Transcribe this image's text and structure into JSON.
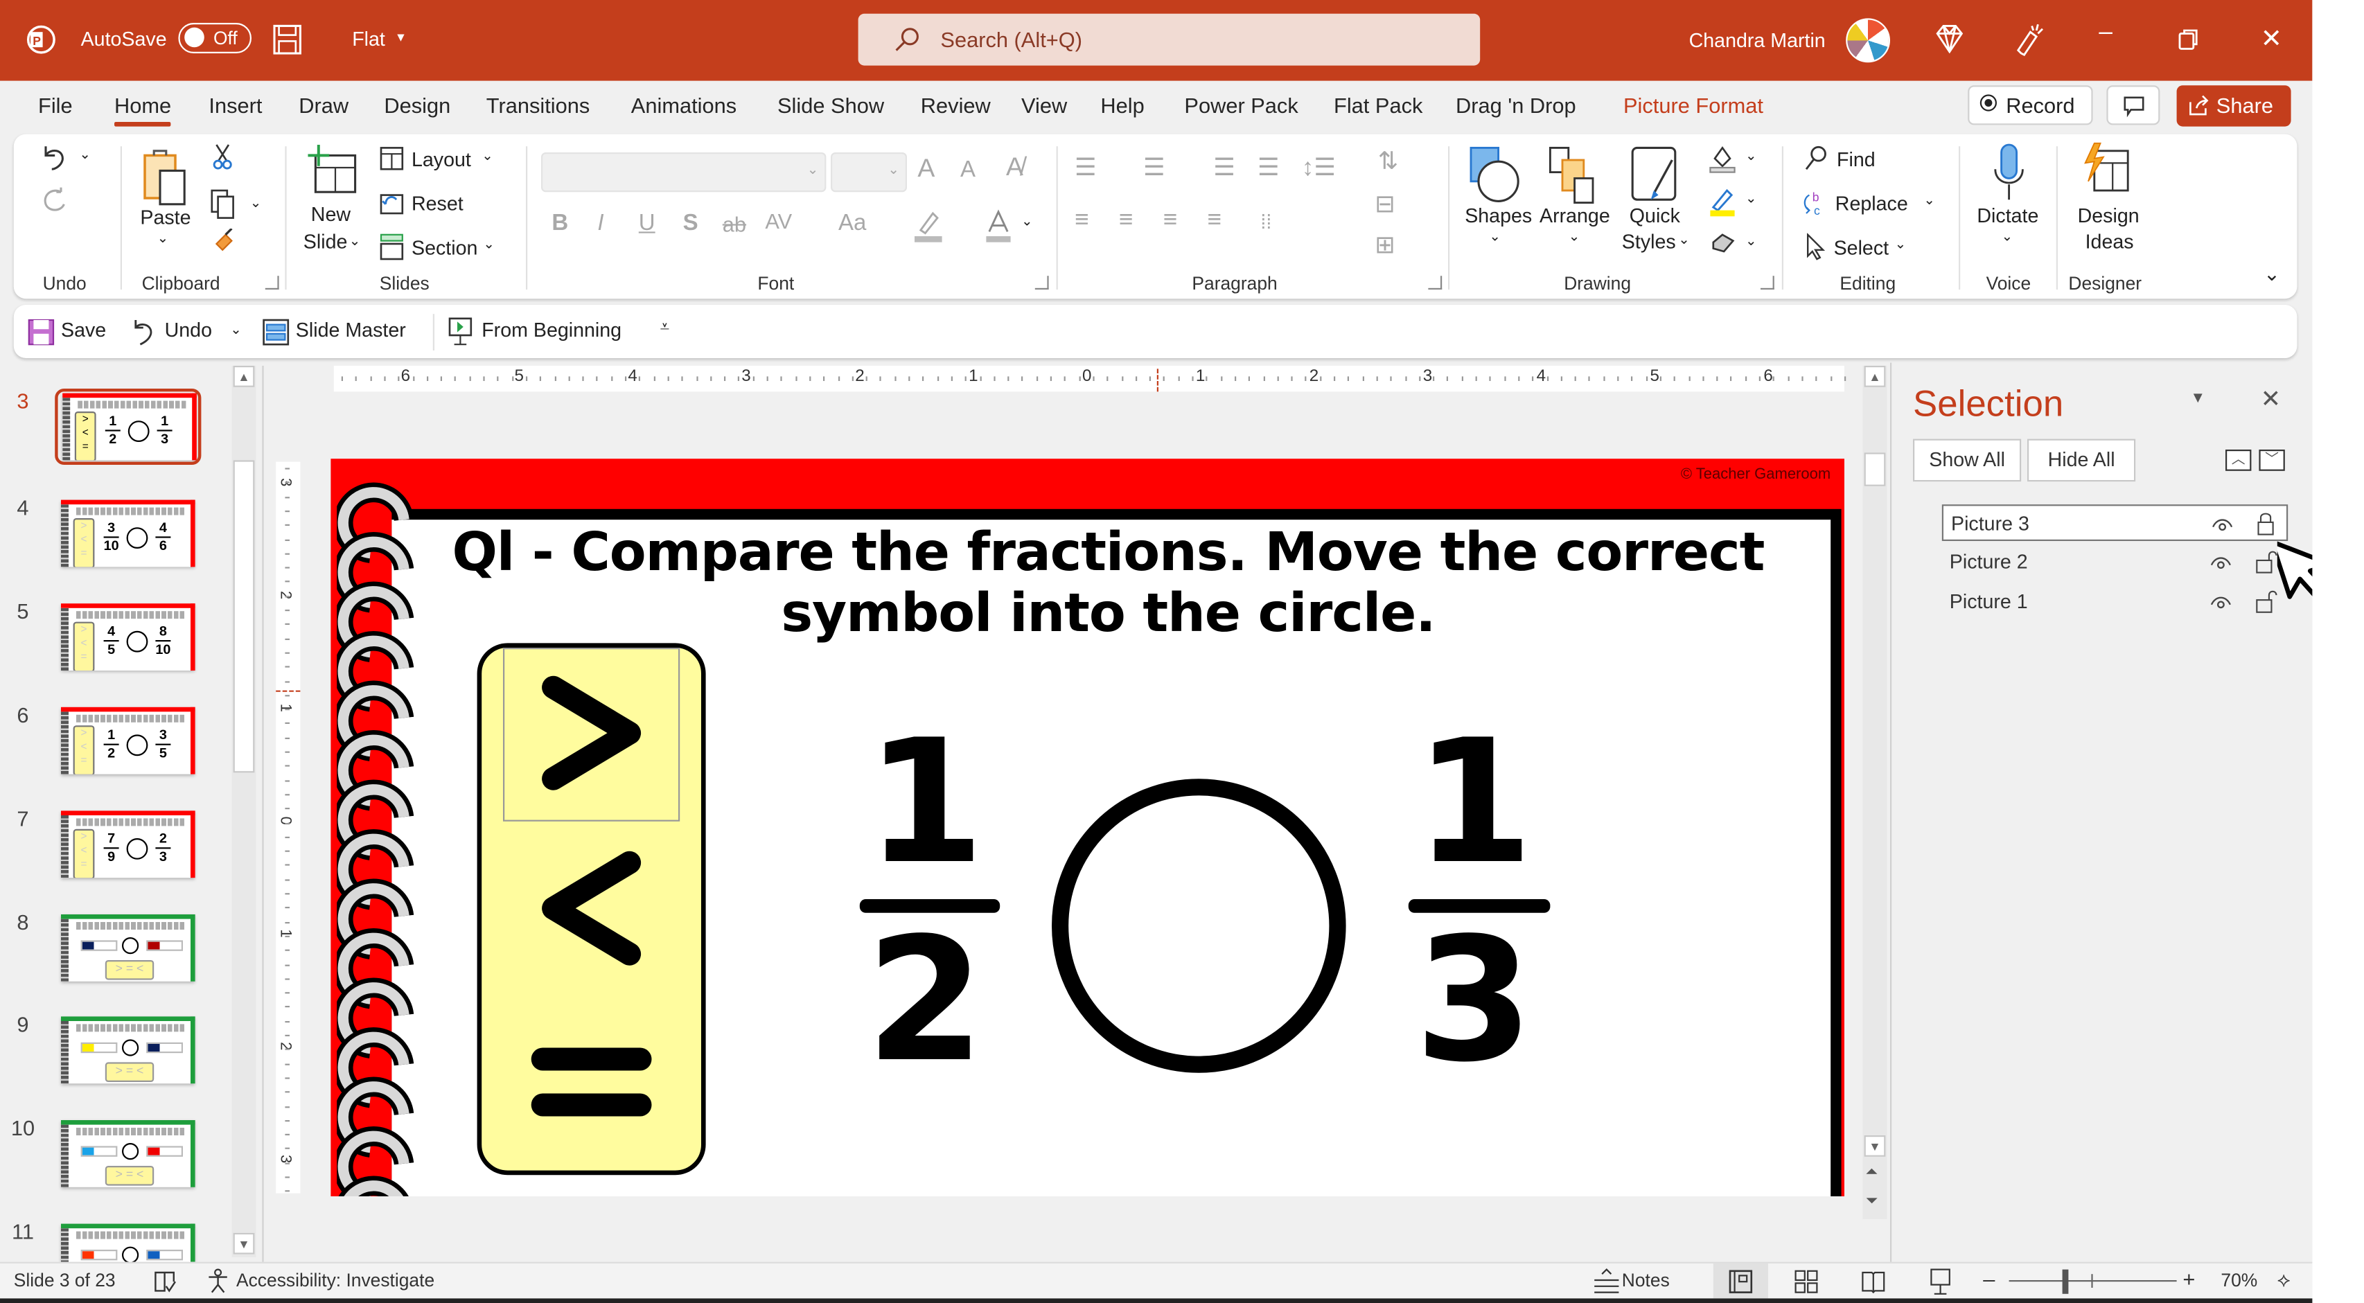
{
  "titlebar": {
    "autosave_label": "AutoSave",
    "autosave_state": "Off",
    "doc_name": "Flat",
    "search_placeholder": "Search (Alt+Q)",
    "user_name": "Chandra Martin",
    "brand_color": "#c43e1c"
  },
  "tabs": [
    {
      "label": "File"
    },
    {
      "label": "Home",
      "active": true
    },
    {
      "label": "Insert"
    },
    {
      "label": "Draw"
    },
    {
      "label": "Design"
    },
    {
      "label": "Transitions"
    },
    {
      "label": "Animations"
    },
    {
      "label": "Slide Show"
    },
    {
      "label": "Review"
    },
    {
      "label": "View"
    },
    {
      "label": "Help"
    },
    {
      "label": "Power Pack"
    },
    {
      "label": "Flat Pack"
    },
    {
      "label": "Drag 'n Drop"
    },
    {
      "label": "Picture Format",
      "contextual": true
    }
  ],
  "header_buttons": {
    "record": "Record",
    "share": "Share"
  },
  "ribbon": {
    "groups": {
      "undo": "Undo",
      "clipboard": "Clipboard",
      "slides": "Slides",
      "font": "Font",
      "paragraph": "Paragraph",
      "drawing": "Drawing",
      "editing": "Editing",
      "voice": "Voice",
      "designer": "Designer"
    },
    "clipboard": {
      "paste": "Paste"
    },
    "slides": {
      "new_slide_1": "New",
      "new_slide_2": "Slide",
      "layout": "Layout",
      "reset": "Reset",
      "section": "Section"
    },
    "font": {
      "bold": "B",
      "italic": "I",
      "underline": "U",
      "shadow": "S",
      "strike": "ab",
      "spacing": "AV",
      "case": "Aa",
      "grow": "A",
      "shrink": "A"
    },
    "drawing": {
      "shapes": "Shapes",
      "arrange": "Arrange",
      "quick_styles_1": "Quick",
      "quick_styles_2": "Styles"
    },
    "editing": {
      "find": "Find",
      "replace": "Replace",
      "select": "Select"
    },
    "voice": {
      "dictate": "Dictate"
    },
    "designer": {
      "design_ideas_1": "Design",
      "design_ideas_2": "Ideas"
    }
  },
  "qat": {
    "save": "Save",
    "undo": "Undo",
    "slide_master": "Slide Master",
    "from_beginning": "From Beginning"
  },
  "thumbnails": [
    {
      "num": "3",
      "current": true,
      "theme": "red",
      "left": "1/2",
      "right": "1/3"
    },
    {
      "num": "4",
      "theme": "red",
      "left": "3/10",
      "right": "4/6"
    },
    {
      "num": "5",
      "theme": "red",
      "left": "4/5",
      "right": "8/10"
    },
    {
      "num": "6",
      "theme": "red",
      "left": "1/2",
      "right": "3/5"
    },
    {
      "num": "7",
      "theme": "red",
      "left": "7/9",
      "right": "2/3"
    },
    {
      "num": "8",
      "theme": "green",
      "bars": [
        "#0a1f5c",
        "#b00000"
      ]
    },
    {
      "num": "9",
      "theme": "green",
      "bars": [
        "#ffee00",
        "#0a1f5c"
      ]
    },
    {
      "num": "10",
      "theme": "green",
      "bars": [
        "#1aa3e8",
        "#f00000"
      ]
    },
    {
      "num": "11",
      "theme": "green",
      "bars": [
        "#ff3300",
        "#1060c0"
      ]
    }
  ],
  "ruler": {
    "horizontal": [
      "6",
      "5",
      "4",
      "3",
      "2",
      "1",
      "0",
      "1",
      "2",
      "3",
      "4",
      "5",
      "6"
    ],
    "vertical": [
      "3",
      "2",
      "1",
      "0",
      "1",
      "2",
      "3"
    ]
  },
  "slide": {
    "copyright": "© Teacher Gameroom",
    "title_line1": "Ql - Compare the fractions. Move the correct",
    "title_line2": "symbol into the circle.",
    "symbols": [
      ">",
      "<",
      "="
    ],
    "left_fraction": {
      "numerator": "1",
      "denominator": "2"
    },
    "right_fraction": {
      "numerator": "1",
      "denominator": "3"
    },
    "border_color": "#ff0000",
    "symbol_box_color": "#fffc9e"
  },
  "selection_pane": {
    "title": "Selection",
    "show_all": "Show All",
    "hide_all": "Hide All",
    "items": [
      {
        "name": "Picture 3",
        "selected": true,
        "visible": true,
        "locked": true
      },
      {
        "name": "Picture 2",
        "selected": false,
        "visible": true,
        "locked": false
      },
      {
        "name": "Picture 1",
        "selected": false,
        "visible": true,
        "locked": false
      }
    ]
  },
  "status": {
    "slide_info": "Slide 3 of 23",
    "accessibility": "Accessibility: Investigate",
    "notes": "Notes",
    "zoom": "70%"
  }
}
